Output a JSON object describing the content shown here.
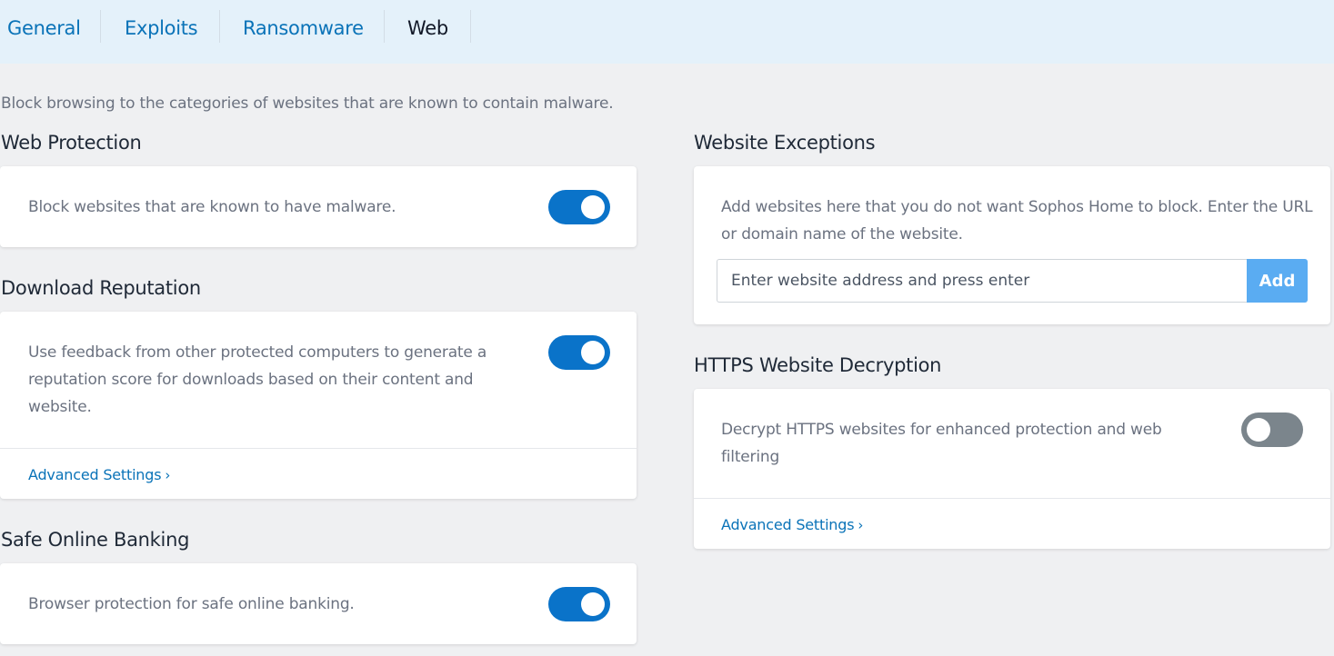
{
  "tabs": [
    {
      "label": "General",
      "active": false
    },
    {
      "label": "Exploits",
      "active": false
    },
    {
      "label": "Ransomware",
      "active": false
    },
    {
      "label": "Web",
      "active": true
    }
  ],
  "intro": "Block browsing to the categories of websites that are known to contain malware.",
  "web_protection": {
    "title": "Web Protection",
    "description": "Block websites that are known to have malware.",
    "enabled": true
  },
  "download_reputation": {
    "title": "Download Reputation",
    "description": "Use feedback from other protected computers to generate a reputation score for downloads based on their content and website.",
    "enabled": true,
    "advanced_label": "Advanced Settings"
  },
  "safe_banking": {
    "title": "Safe Online Banking",
    "description": "Browser protection for safe online banking.",
    "enabled": true
  },
  "website_exceptions": {
    "title": "Website Exceptions",
    "description": "Add websites here that you do not want Sophos Home to block. Enter the URL or domain name of the website.",
    "input_value": "",
    "input_placeholder": "Enter website address and press enter",
    "add_label": "Add"
  },
  "https_decryption": {
    "title": "HTTPS Website Decryption",
    "description": "Decrypt HTTPS websites for enhanced protection and web filtering",
    "enabled": false,
    "advanced_label": "Advanced Settings"
  },
  "colors": {
    "accent": "#0a73c9",
    "link": "#0a73b8",
    "add_button": "#5aacf2",
    "toggle_off": "#7b858c",
    "tabbar_bg": "#e4f1fa",
    "page_bg": "#eff0f2"
  }
}
